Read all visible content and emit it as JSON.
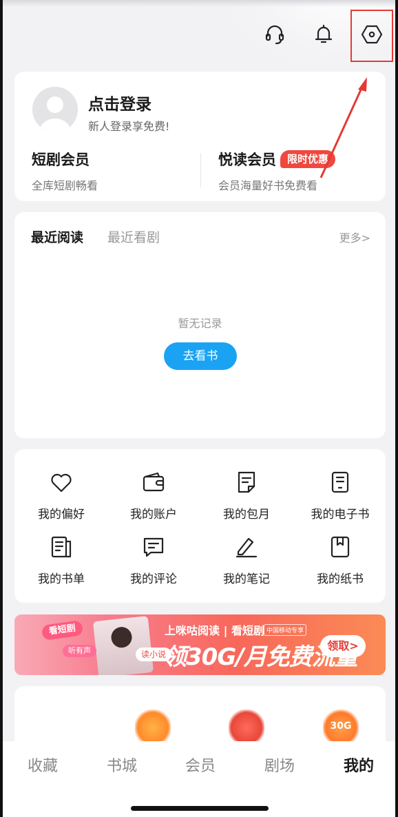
{
  "top_bar": {
    "icons": [
      "headset-icon",
      "bell-icon",
      "settings-icon"
    ]
  },
  "login": {
    "title": "点击登录",
    "subtitle": "新人登录享免费!"
  },
  "members": [
    {
      "title": "短剧会员",
      "desc": "全库短剧畅看",
      "badge": ""
    },
    {
      "title": "悦读会员",
      "desc": "会员海量好书免费看",
      "badge": "限时优惠"
    }
  ],
  "recent": {
    "tabs": [
      "最近阅读",
      "最近看剧"
    ],
    "more": "更多>",
    "empty_text": "暂无记录",
    "button": "去看书"
  },
  "grid": {
    "items": [
      {
        "label": "我的偏好",
        "icon": "heart-icon"
      },
      {
        "label": "我的账户",
        "icon": "wallet-icon"
      },
      {
        "label": "我的包月",
        "icon": "document-icon"
      },
      {
        "label": "我的电子书",
        "icon": "ebook-icon"
      },
      {
        "label": "我的书单",
        "icon": "booklist-icon"
      },
      {
        "label": "我的评论",
        "icon": "comment-icon"
      },
      {
        "label": "我的笔记",
        "icon": "pen-icon"
      },
      {
        "label": "我的纸书",
        "icon": "bookmark-book-icon"
      }
    ]
  },
  "banner": {
    "pill1": "看短剧",
    "pill2": "听有声",
    "pill3": "读小说",
    "top_text": "上咪咕阅读 | 看短剧",
    "tag": "中国移动专享",
    "main_text": "领30G/月免费流量",
    "button": "领取>"
  },
  "gifts": {
    "third_label": "30G"
  },
  "bottom_nav": {
    "items": [
      "收藏",
      "书城",
      "会员",
      "剧场",
      "我的"
    ],
    "active_index": 4
  },
  "colors": {
    "accent_blue": "#1aa3f3",
    "promo_red": "#f0483e",
    "highlight_red": "#e53935"
  }
}
